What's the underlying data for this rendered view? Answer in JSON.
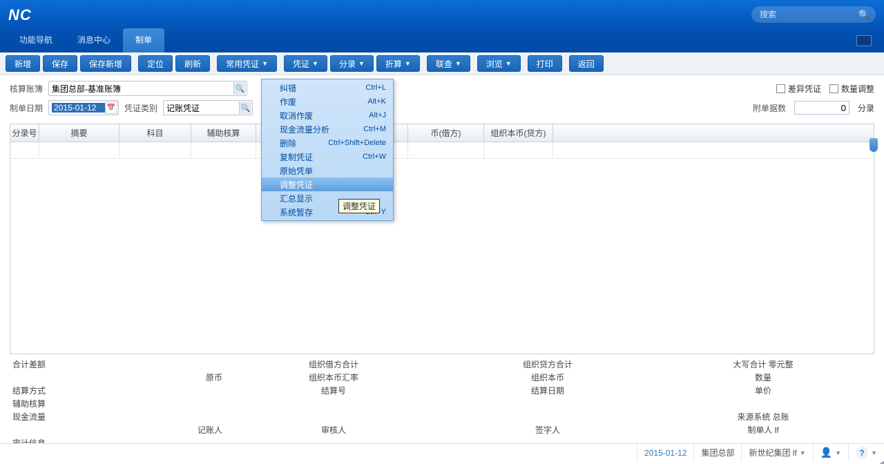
{
  "header": {
    "search_placeholder": "搜索"
  },
  "nav": {
    "items": [
      "功能导航",
      "消息中心",
      "制单"
    ],
    "active_index": 2
  },
  "toolbar": {
    "buttons": [
      {
        "label": "新增",
        "dd": false
      },
      {
        "label": "保存",
        "dd": false
      },
      {
        "label": "保存新增",
        "dd": false
      },
      {
        "label": "定位",
        "dd": false
      },
      {
        "label": "刷新",
        "dd": false
      },
      {
        "label": "常用凭证",
        "dd": true
      },
      {
        "label": "凭证",
        "dd": true
      },
      {
        "label": "分录",
        "dd": true
      },
      {
        "label": "折算",
        "dd": true
      },
      {
        "label": "联查",
        "dd": true
      },
      {
        "label": "浏览",
        "dd": true
      },
      {
        "label": "打印",
        "dd": false
      },
      {
        "label": "返回",
        "dd": false
      }
    ]
  },
  "form": {
    "book_label": "核算账簿",
    "book_value": "集团总部-基准账簿",
    "date_label": "制单日期",
    "date_value": "2015-01-12",
    "type_label": "凭证类别",
    "type_value": "记账凭证",
    "chk_diff": "差异凭证",
    "chk_qty": "数量调整",
    "att_label": "附单据数",
    "att_value": "0",
    "att_unit": "分录"
  },
  "table": {
    "cols": [
      "分录号",
      "摘要",
      "科目",
      "辅助核算",
      "",
      "币(借方)",
      "组织本币(贷方)"
    ]
  },
  "dropdown": {
    "items": [
      {
        "label": "纠错",
        "short": "Ctrl+L"
      },
      {
        "label": "作废",
        "short": "Alt+K"
      },
      {
        "label": "取消作废",
        "short": "Alt+J"
      },
      {
        "label": "现金流量分析",
        "short": "Ctrl+M"
      },
      {
        "label": "删除",
        "short": "Ctrl+Shift+Delete"
      },
      {
        "label": "复制凭证",
        "short": "Ctrl+W"
      },
      {
        "label": "原始凭单",
        "short": ""
      },
      {
        "label": "调整凭证",
        "short": ""
      },
      {
        "label": "汇总显示",
        "short": ""
      },
      {
        "label": "系统暂存",
        "short": "Ctrl+Y"
      }
    ],
    "hover_index": 7,
    "tooltip": "调整凭证"
  },
  "summary": {
    "r1": {
      "a": "合计差额",
      "b": "组织借方合计",
      "c": "组织贷方合计",
      "d": "大写合计  零元整"
    },
    "r2": {
      "a": "原币",
      "b": "组织本币汇率",
      "c": "组织本币",
      "d": "数量"
    },
    "r3": {
      "a": "结算方式",
      "b": "结算号",
      "c": "结算日期",
      "d": "单价"
    },
    "r4": {
      "a": "辅助核算",
      "b": "",
      "c": "",
      "d": ""
    },
    "r5": {
      "a": "现金流量",
      "b": "",
      "c": "",
      "d": "来源系统  总账"
    },
    "r6": {
      "a": "记账人",
      "b": "审核人",
      "c": "签字人",
      "d": "制单人  lf"
    },
    "r7": {
      "a": "审计信息",
      "b": "",
      "c": "",
      "d": ""
    }
  },
  "status": {
    "date": "2015-01-12",
    "org": "集团总部",
    "group": "新世纪集团  lf"
  }
}
